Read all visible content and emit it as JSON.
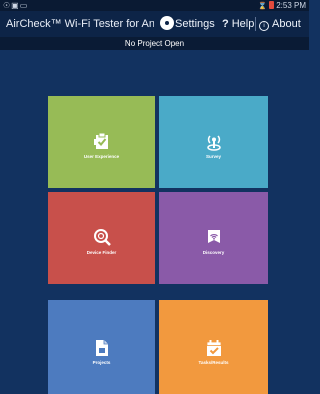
{
  "status_bar": {
    "time": "2:53 PM",
    "left_icons": "usb-icon, image-icon, cast-icon"
  },
  "action_bar": {
    "title": "AirCheck™ Wi-Fi Tester for And",
    "settings_label": "Settings",
    "help_label": "Help",
    "about_label": "About"
  },
  "project_bar": {
    "text": "No Project Open"
  },
  "tiles": [
    {
      "label": "User Experience",
      "color": "#97bb56",
      "icon": "clipboard-check-icon"
    },
    {
      "label": "Survey",
      "color": "#4aaac8",
      "icon": "signal-walker-icon"
    },
    {
      "label": "Device Finder",
      "color": "#c8504b",
      "icon": "magnifier-icon"
    },
    {
      "label": "Discovery",
      "color": "#8a5aa8",
      "icon": "wifi-tag-icon"
    },
    {
      "label": "Projects",
      "color": "#4d7bbf",
      "icon": "document-icon"
    },
    {
      "label": "Tasks/Results",
      "color": "#f2993e",
      "icon": "calendar-check-icon"
    }
  ],
  "colors": {
    "background": "#123260",
    "action_bar": "#0d2447"
  }
}
